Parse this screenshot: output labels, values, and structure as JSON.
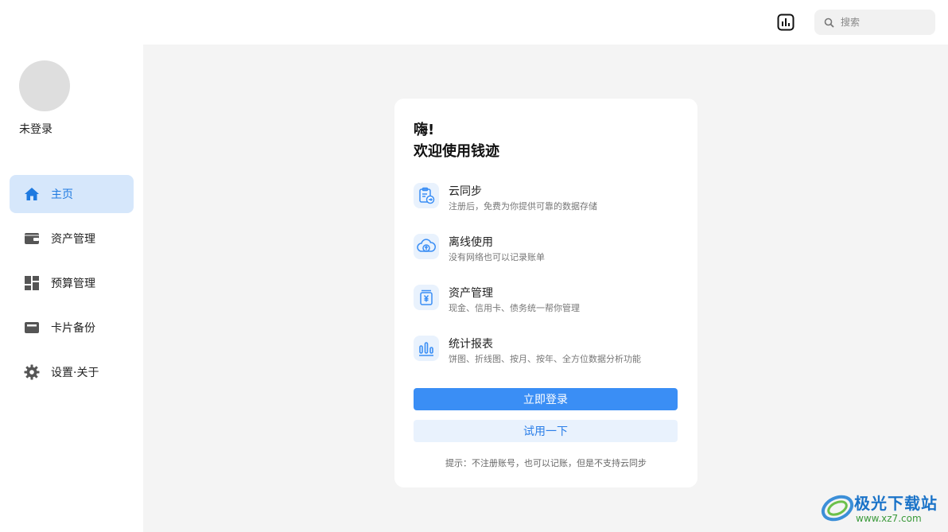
{
  "header": {
    "search_placeholder": "搜索",
    "stats_icon": "bar-chart-icon"
  },
  "sidebar": {
    "user_status": "未登录",
    "items": [
      {
        "label": "主页",
        "icon": "home-icon",
        "active": true
      },
      {
        "label": "资产管理",
        "icon": "wallet-icon",
        "active": false
      },
      {
        "label": "预算管理",
        "icon": "dashboard-icon",
        "active": false
      },
      {
        "label": "卡片备份",
        "icon": "card-icon",
        "active": false
      },
      {
        "label": "设置·关于",
        "icon": "gear-icon",
        "active": false
      }
    ]
  },
  "welcome": {
    "greeting": "嗨!",
    "subtitle": "欢迎使用钱迹",
    "features": [
      {
        "title": "云同步",
        "desc": "注册后，免费为你提供可靠的数据存储",
        "icon": "clipboard-sync-icon"
      },
      {
        "title": "离线使用",
        "desc": "没有网络也可以记录账单",
        "icon": "cloud-upload-icon"
      },
      {
        "title": "资产管理",
        "desc": "现金、信用卡、债务统一帮你管理",
        "icon": "yuan-jar-icon"
      },
      {
        "title": "统计报表",
        "desc": "饼图、折线图、按月、按年、全方位数据分析功能",
        "icon": "bar-chart-icon"
      }
    ],
    "login_button": "立即登录",
    "try_button": "试用一下",
    "hint": "提示：不注册账号，也可以记账，但是不支持云同步"
  },
  "watermark": {
    "title": "极光下载站",
    "url": "www.xz7.com"
  },
  "colors": {
    "accent": "#3a8ef5",
    "active_nav_bg": "#d6e7fb",
    "icon_bg": "#e9f2fd",
    "page_bg": "#f4f4f4"
  }
}
